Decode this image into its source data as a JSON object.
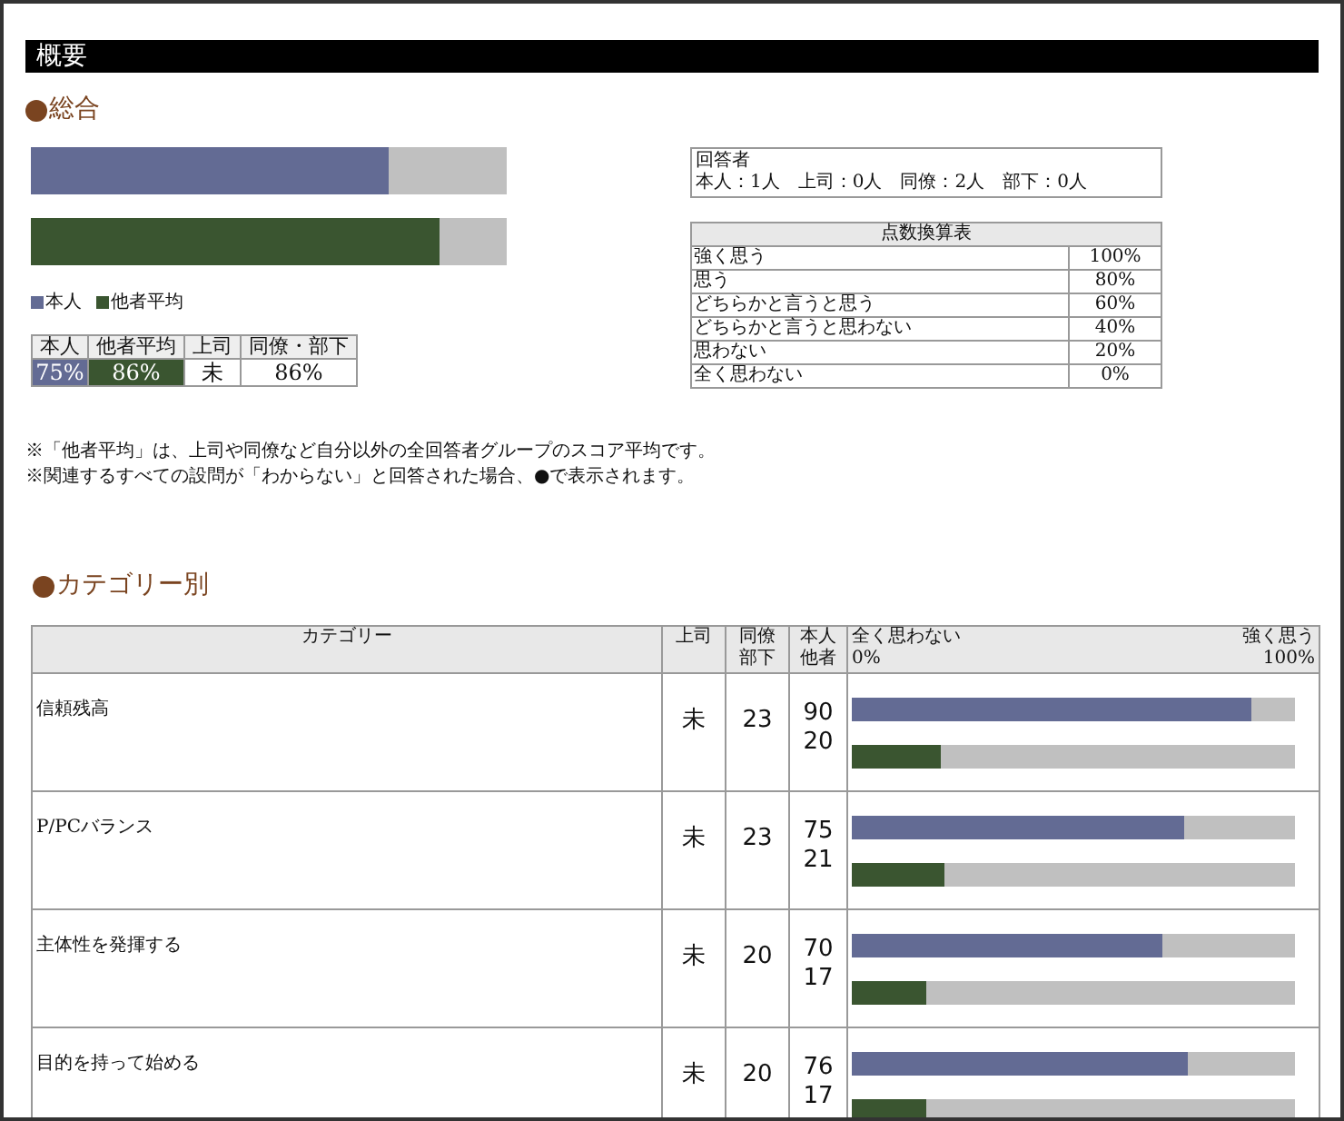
{
  "title": "概要",
  "overall": {
    "heading": "総合",
    "bars": [
      {
        "color": "#636b94",
        "level": 0.75
      },
      {
        "color": "#3a5530",
        "level": 0.86
      }
    ],
    "legend": [
      {
        "label": "本人",
        "color": "#636b94"
      },
      {
        "label": "他者平均",
        "color": "#3a5530"
      }
    ],
    "summary": {
      "columns": [
        "本人",
        "他者平均",
        "上司",
        "同僚・部下"
      ],
      "cells": [
        {
          "value": "75%",
          "color": "#636b94"
        },
        {
          "value": "86%",
          "color": "#3a5530"
        },
        {
          "value": "未"
        },
        {
          "value": "86%"
        }
      ]
    },
    "respondents": {
      "label": "回答者",
      "counts": "本人：1人　上司：0人　同僚：2人　部下：0人"
    },
    "score_table": {
      "title": "点数換算表",
      "rows": [
        {
          "answer": "強く思う",
          "score": "100%"
        },
        {
          "answer": "思う",
          "score": "80%"
        },
        {
          "answer": "どちらかと言うと思う",
          "score": "60%"
        },
        {
          "answer": "どちらかと言うと思わない",
          "score": "40%"
        },
        {
          "answer": "思わない",
          "score": "20%"
        },
        {
          "answer": "全く思わない",
          "score": "0%"
        }
      ]
    },
    "notes": [
      "※「他者平均」は、上司や同僚など自分以外の全回答者グループのスコア平均です。",
      "※関連するすべての設問が「わからない」と回答された場合、●で表示されます。"
    ]
  },
  "by_category": {
    "heading": "カテゴリー別",
    "columns": {
      "category": "カテゴリー",
      "boss": "上司",
      "peers": [
        "同僚",
        "部下"
      ],
      "self_others": [
        "本人",
        "他者"
      ],
      "scale_left": "全く思わない",
      "scale_right": "強く思う",
      "scale_min": "0%",
      "scale_max": "100%"
    },
    "rows": [
      {
        "category": "信頼残高",
        "boss": "未",
        "peers": "23",
        "self": "90",
        "others": "20",
        "bars": [
          {
            "level": 0.9
          },
          {
            "level": 0.2
          }
        ]
      },
      {
        "category": "P/PCバランス",
        "boss": "未",
        "peers": "23",
        "self": "75",
        "others": "21",
        "bars": [
          {
            "level": 0.75
          },
          {
            "level": 0.21
          }
        ]
      },
      {
        "category": "主体性を発揮する",
        "boss": "未",
        "peers": "20",
        "self": "70",
        "others": "17",
        "bars": [
          {
            "level": 0.7
          },
          {
            "level": 0.17
          }
        ]
      },
      {
        "category": "目的を持って始める",
        "boss": "未",
        "peers": "20",
        "self": "76",
        "others": "17",
        "bars": [
          {
            "level": 0.76
          },
          {
            "level": 0.17
          }
        ]
      }
    ]
  }
}
